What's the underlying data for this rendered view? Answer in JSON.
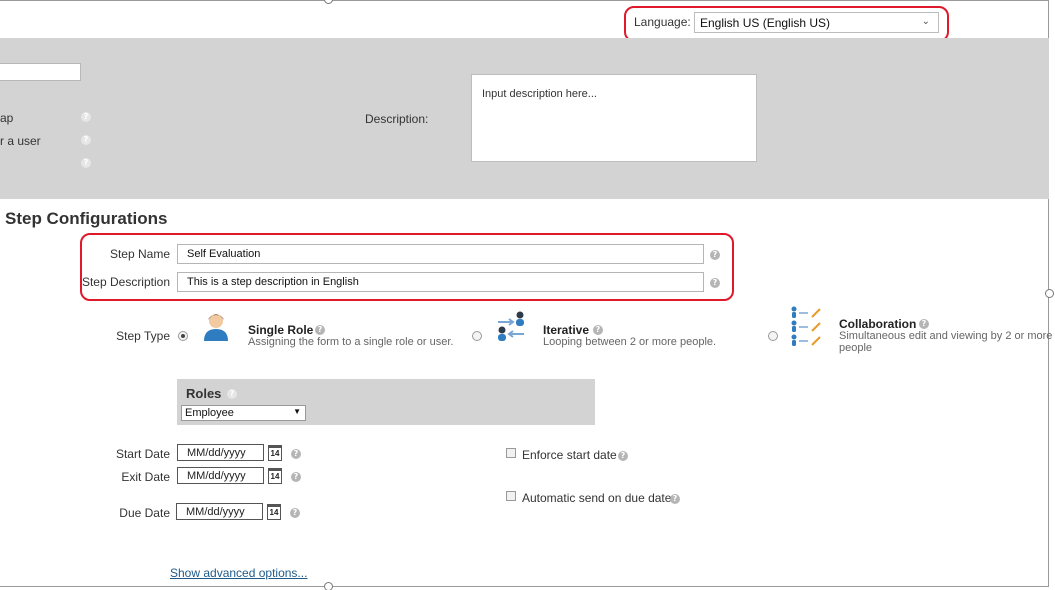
{
  "header": {
    "language_label": "Language:",
    "language_value": "English US (English US)"
  },
  "top_section": {
    "partial_labels": [
      "ap",
      "r a user"
    ],
    "description_label": "Description:",
    "description_placeholder": "Input description here..."
  },
  "step_config": {
    "title": "Step Configurations",
    "step_name_label": "Step Name",
    "step_name_value": "Self Evaluation",
    "step_description_label": "Step Description",
    "step_description_value": "This is a step description in English",
    "step_type_label": "Step Type",
    "step_types": [
      {
        "title": "Single Role",
        "subtitle": "Assigning the form to a single role or user.",
        "selected": true,
        "icon": "single-role-icon"
      },
      {
        "title": "Iterative",
        "subtitle": "Looping between 2 or more people.",
        "selected": false,
        "icon": "iterative-icon"
      },
      {
        "title": "Collaboration",
        "subtitle_line1": "Simultaneous edit and viewing by 2 or more",
        "subtitle_line2": "people",
        "selected": false,
        "icon": "collaboration-icon"
      }
    ],
    "roles": {
      "title": "Roles",
      "selected": "Employee"
    },
    "dates": {
      "start_label": "Start Date",
      "exit_label": "Exit Date",
      "due_label": "Due Date",
      "placeholder": "MM/dd/yyyy",
      "calendar_day": "14"
    },
    "options": {
      "enforce_start_date": "Enforce start date",
      "automatic_send": "Automatic send on due date"
    },
    "advanced_link": "Show advanced options..."
  },
  "colors": {
    "highlight": "#e0182b",
    "gray_band": "#d3d3d3",
    "link": "#1f5a8b"
  }
}
